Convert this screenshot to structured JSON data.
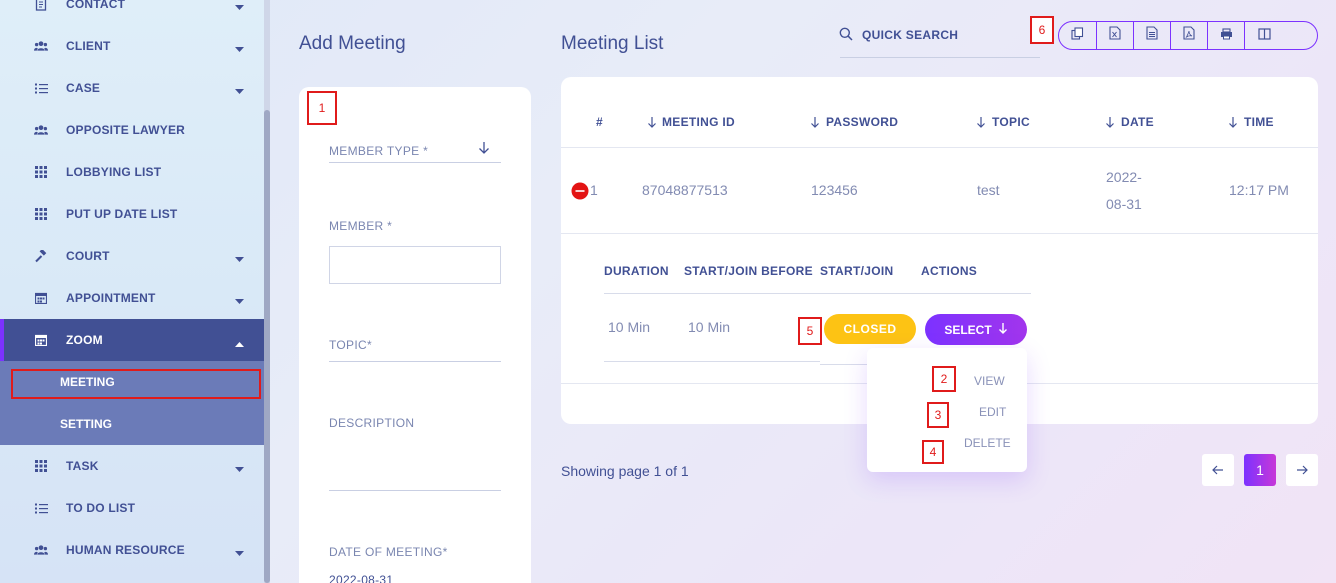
{
  "sidebar": {
    "items": [
      {
        "label": "CONTACT",
        "icon": "address-book-icon",
        "caret": true
      },
      {
        "label": "CLIENT",
        "icon": "users-icon",
        "caret": true
      },
      {
        "label": "CASE",
        "icon": "list-icon",
        "caret": true
      },
      {
        "label": "OPPOSITE LAWYER",
        "icon": "users-icon",
        "caret": false
      },
      {
        "label": "LOBBYING LIST",
        "icon": "grid-icon",
        "caret": false
      },
      {
        "label": "PUT UP DATE LIST",
        "icon": "grid-icon",
        "caret": false
      },
      {
        "label": "COURT",
        "icon": "gavel-icon",
        "caret": true
      },
      {
        "label": "APPOINTMENT",
        "icon": "calendar-icon",
        "caret": true
      },
      {
        "label": "ZOOM",
        "icon": "calendar-icon",
        "caret": true,
        "active": true
      },
      {
        "label": "TASK",
        "icon": "grid-icon",
        "caret": true
      },
      {
        "label": "TO DO LIST",
        "icon": "list-icon",
        "caret": false
      },
      {
        "label": "HUMAN RESOURCE",
        "icon": "users-icon",
        "caret": true
      }
    ],
    "sub_items": [
      "MEETING",
      "SETTING"
    ]
  },
  "add_meeting": {
    "title": "Add Meeting",
    "member_type_label": "MEMBER TYPE *",
    "member_label": "MEMBER *",
    "topic_label": "TOPIC*",
    "description_label": "DESCRIPTION",
    "date_label": "DATE OF MEETING*",
    "date_value": "2022-08-31"
  },
  "meeting_list": {
    "title": "Meeting List",
    "search_placeholder": "QUICK SEARCH",
    "columns": [
      "#",
      "MEETING ID",
      "PASSWORD",
      "TOPIC",
      "DATE",
      "TIME"
    ],
    "row": {
      "num": "1",
      "meeting_id": "87048877513",
      "password": "123456",
      "topic": "test",
      "date_line1": "2022-",
      "date_line2": "08-31",
      "time": "12:17 PM"
    },
    "child_columns": [
      "DURATION",
      "START/JOIN BEFORE",
      "START/JOIN",
      "ACTIONS"
    ],
    "child_row": {
      "duration": "10 Min",
      "start_join_before": "10 Min",
      "status": "CLOSED",
      "select_label": "SELECT"
    },
    "actions_menu": [
      "VIEW",
      "EDIT",
      "DELETE"
    ],
    "pagination_text": "Showing page 1 of 1",
    "current_page": "1"
  },
  "annotations": [
    "1",
    "2",
    "3",
    "4",
    "5",
    "6"
  ],
  "colors": {
    "primary": "#415094",
    "accent": "#7c32ff",
    "closed_badge": "#fdc314",
    "annotation_red": "#e01b1b"
  }
}
